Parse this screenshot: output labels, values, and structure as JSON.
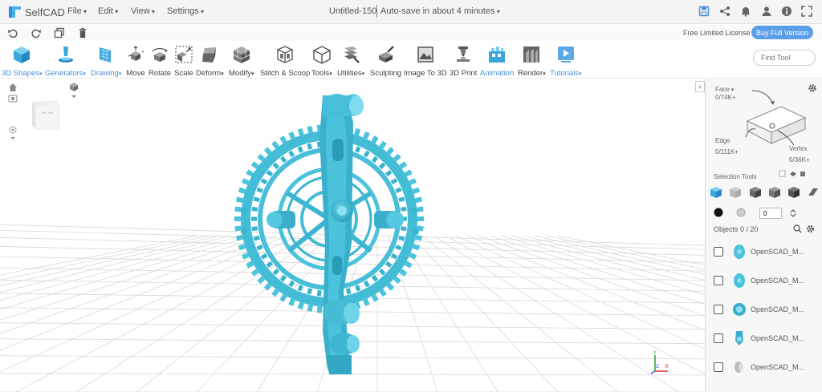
{
  "app": {
    "name": "SelfCAD"
  },
  "menubar": {
    "file": "File",
    "edit": "Edit",
    "view": "View",
    "settings": "Settings"
  },
  "document": {
    "title": "Untitled-150",
    "autosave": "Auto-save in about 4 minutes"
  },
  "license": {
    "label": "Free Limited License",
    "buy": "Buy Full Version"
  },
  "toolbar": {
    "shapes": "3D Shapes",
    "generators": "Generators",
    "drawing": "Drawing",
    "move": "Move",
    "rotate": "Rotate",
    "scale": "Scale",
    "deform": "Deform",
    "modify": "Modify",
    "stitch": "Stitch & Scoop",
    "tools": "Tools",
    "utilities": "Utilities",
    "sculpting": "Sculpting",
    "image_to_3d": "Image To 3D",
    "print": "3D Print",
    "animation": "Animation",
    "render": "Render",
    "tutorials": "Tutorials",
    "find_tool": "Find Tool"
  },
  "panel": {
    "face": "Face",
    "face_count": "0/74K+",
    "edge": "Edge",
    "edge_count": "0/111K+",
    "vertex": "Vertex",
    "vertex_count": "0/36K+",
    "selection_tools": "Selection Tools",
    "count_value": "0",
    "objects": "Objects 0 / 20",
    "items": [
      {
        "name": "OpenSCAD_M..."
      },
      {
        "name": "OpenSCAD_M..."
      },
      {
        "name": "OpenSCAD_M..."
      },
      {
        "name": "OpenSCAD_M..."
      },
      {
        "name": "OpenSCAD_M..."
      }
    ]
  },
  "colors": {
    "accent": "#5b9ee8",
    "model": "#4cc3dc",
    "model_dark": "#2ea7c2"
  }
}
